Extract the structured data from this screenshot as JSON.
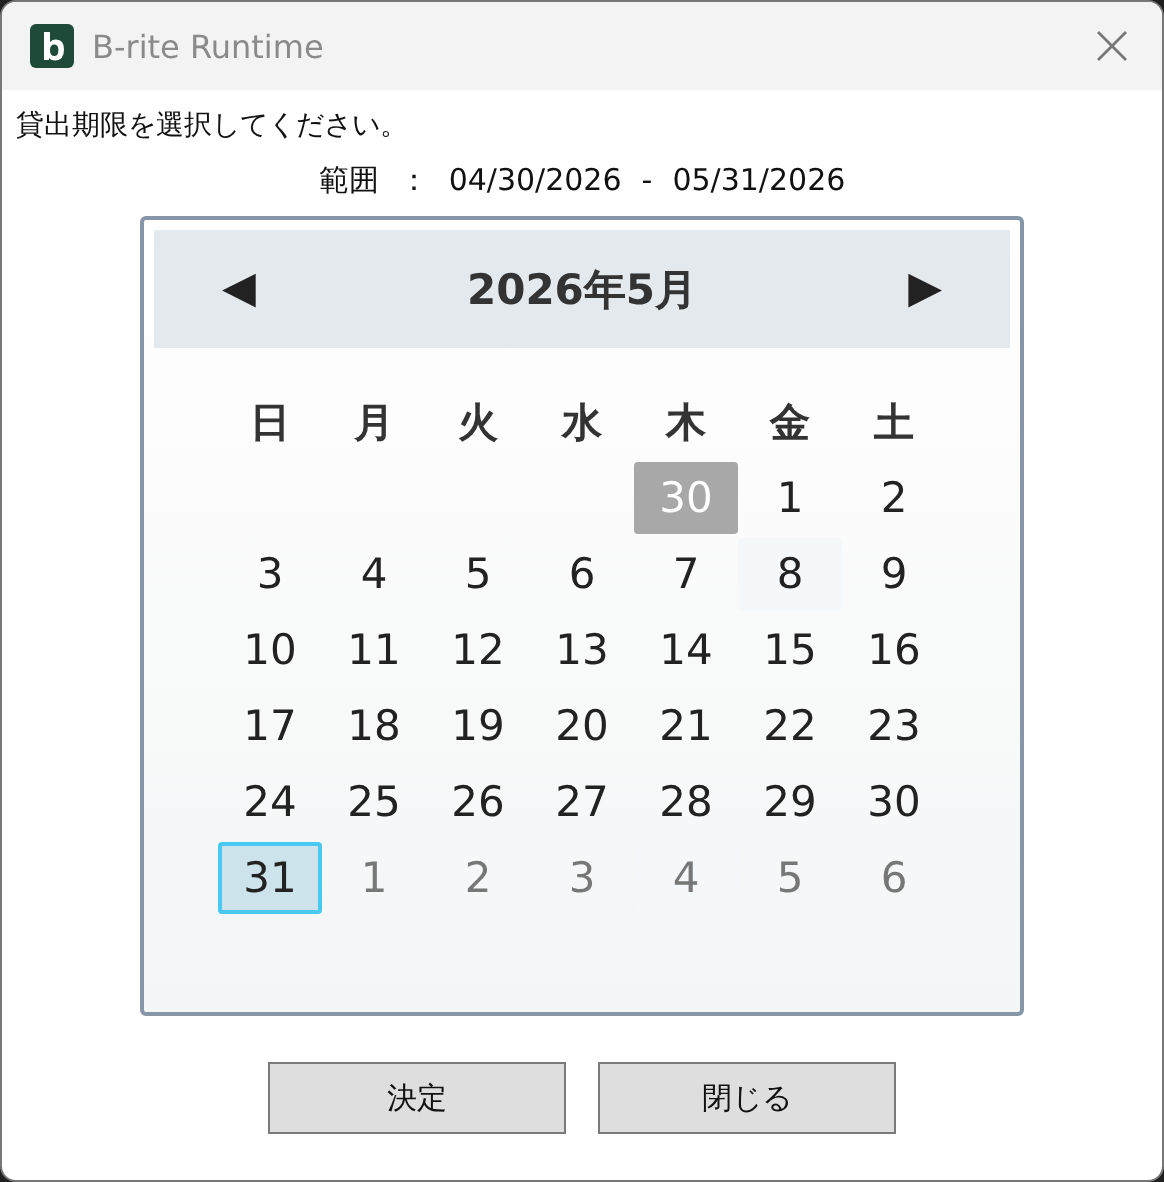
{
  "window": {
    "title": "B-rite Runtime"
  },
  "prompt": "貸出期限を選択してください。",
  "range": {
    "label": "範囲",
    "separator": "：",
    "start": "04/30/2026",
    "dash": "-",
    "end": "05/31/2026"
  },
  "calendar": {
    "prev": "◀",
    "month_title": "2026年5月",
    "next": "▶",
    "weekdays": [
      "日",
      "月",
      "火",
      "水",
      "木",
      "金",
      "土"
    ],
    "weeks": [
      [
        {
          "label": "30",
          "kind": "range-start",
          "selected": false,
          "other_month": false
        },
        {
          "label": "1",
          "kind": "plain",
          "selected": false,
          "other_month": false
        },
        {
          "label": "2",
          "kind": "plain",
          "selected": false,
          "other_month": false
        }
      ],
      [
        {
          "label": "3",
          "kind": "plain",
          "selected": false,
          "other_month": false
        },
        {
          "label": "4",
          "kind": "plain",
          "selected": false,
          "other_month": false
        },
        {
          "label": "5",
          "kind": "plain",
          "selected": false,
          "other_month": false
        },
        {
          "label": "6",
          "kind": "plain",
          "selected": false,
          "other_month": false
        },
        {
          "label": "7",
          "kind": "plain",
          "selected": false,
          "other_month": false
        },
        {
          "label": "8",
          "kind": "shaded",
          "selected": false,
          "other_month": false
        },
        {
          "label": "9",
          "kind": "plain",
          "selected": false,
          "other_month": false
        }
      ],
      [
        {
          "label": "10",
          "kind": "plain",
          "selected": false,
          "other_month": false
        },
        {
          "label": "11",
          "kind": "plain",
          "selected": false,
          "other_month": false
        },
        {
          "label": "12",
          "kind": "plain",
          "selected": false,
          "other_month": false
        },
        {
          "label": "13",
          "kind": "plain",
          "selected": false,
          "other_month": false
        },
        {
          "label": "14",
          "kind": "plain",
          "selected": false,
          "other_month": false
        },
        {
          "label": "15",
          "kind": "plain",
          "selected": false,
          "other_month": false
        },
        {
          "label": "16",
          "kind": "plain",
          "selected": false,
          "other_month": false
        }
      ],
      [
        {
          "label": "17",
          "kind": "plain",
          "selected": false,
          "other_month": false
        },
        {
          "label": "18",
          "kind": "plain",
          "selected": false,
          "other_month": false
        },
        {
          "label": "19",
          "kind": "plain",
          "selected": false,
          "other_month": false
        },
        {
          "label": "20",
          "kind": "plain",
          "selected": false,
          "other_month": false
        },
        {
          "label": "21",
          "kind": "plain",
          "selected": false,
          "other_month": false
        },
        {
          "label": "22",
          "kind": "plain",
          "selected": false,
          "other_month": false
        },
        {
          "label": "23",
          "kind": "plain",
          "selected": false,
          "other_month": false
        }
      ],
      [
        {
          "label": "24",
          "kind": "plain",
          "selected": false,
          "other_month": false
        },
        {
          "label": "25",
          "kind": "plain",
          "selected": false,
          "other_month": false
        },
        {
          "label": "26",
          "kind": "plain",
          "selected": false,
          "other_month": false
        },
        {
          "label": "27",
          "kind": "plain",
          "selected": false,
          "other_month": false
        },
        {
          "label": "28",
          "kind": "plain",
          "selected": false,
          "other_month": false
        },
        {
          "label": "29",
          "kind": "plain",
          "selected": false,
          "other_month": false
        },
        {
          "label": "30",
          "kind": "plain",
          "selected": false,
          "other_month": false
        }
      ],
      [
        {
          "label": "31",
          "kind": "plain",
          "selected": true,
          "other_month": false
        },
        {
          "label": "1",
          "kind": "plain",
          "selected": false,
          "other_month": true
        },
        {
          "label": "2",
          "kind": "plain",
          "selected": false,
          "other_month": true
        },
        {
          "label": "3",
          "kind": "plain",
          "selected": false,
          "other_month": true
        },
        {
          "label": "4",
          "kind": "shaded",
          "selected": false,
          "other_month": true
        },
        {
          "label": "5",
          "kind": "plain",
          "selected": false,
          "other_month": true
        },
        {
          "label": "6",
          "kind": "plain",
          "selected": false,
          "other_month": true
        }
      ]
    ]
  },
  "buttons": [
    "決定",
    "閉じる"
  ]
}
